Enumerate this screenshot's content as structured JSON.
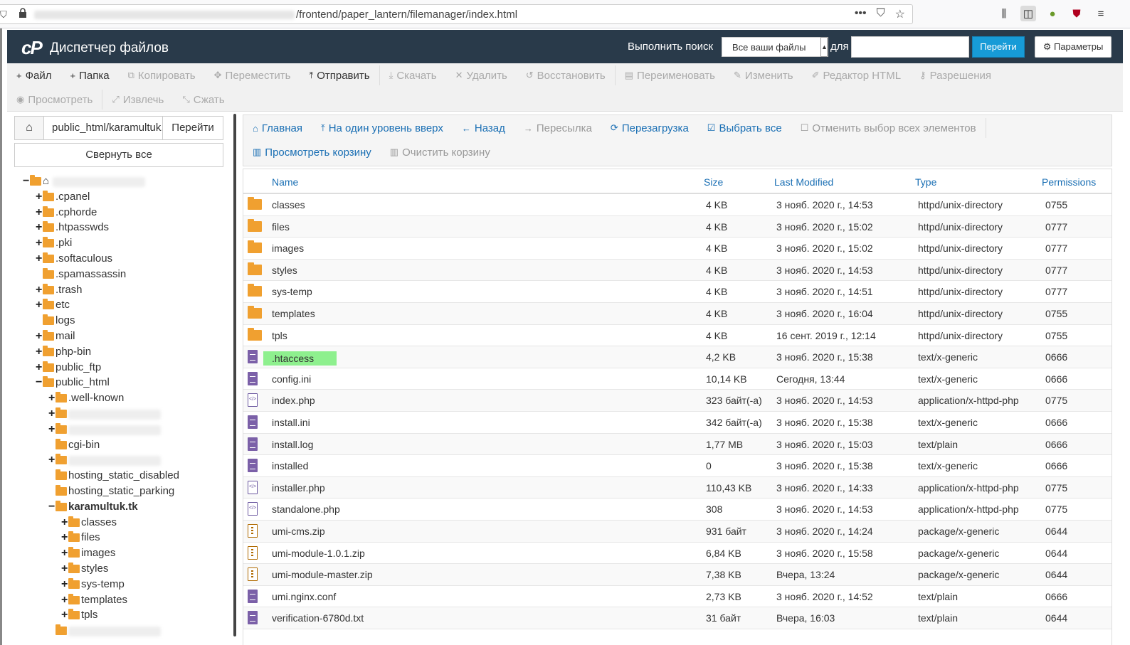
{
  "browser": {
    "url_suffix": "/frontend/paper_lantern/filemanager/index.html",
    "icons": [
      "more-icon",
      "pocket-icon",
      "star-icon",
      "library-icon",
      "sidebar-icon",
      "leaf-icon",
      "ublock-icon",
      "menu-icon"
    ]
  },
  "header": {
    "title": "Диспетчер файлов",
    "search_label": "Выполнить поиск",
    "search_scope": "Все ваши файлы",
    "for_label": "для",
    "go_label": "Перейти",
    "settings_label": "Параметры"
  },
  "toolbar": {
    "row1": [
      {
        "label": "Файл",
        "icon": "+",
        "enabled": true
      },
      {
        "label": "Папка",
        "icon": "+",
        "enabled": true
      },
      {
        "label": "Копировать",
        "icon": "⧉",
        "enabled": false
      },
      {
        "label": "Переместить",
        "icon": "✥",
        "enabled": false
      },
      {
        "label": "Отправить",
        "icon": "⤒",
        "enabled": true
      },
      {
        "label": "Скачать",
        "icon": "⤓",
        "enabled": false
      },
      {
        "label": "Удалить",
        "icon": "✕",
        "enabled": false
      },
      {
        "label": "Восстановить",
        "icon": "↺",
        "enabled": false
      },
      {
        "label": "Переименовать",
        "icon": "▤",
        "enabled": false
      },
      {
        "label": "Изменить",
        "icon": "✎",
        "enabled": false
      },
      {
        "label": "Редактор HTML",
        "icon": "✐",
        "enabled": false
      },
      {
        "label": "Разрешения",
        "icon": "⚷",
        "enabled": false
      }
    ],
    "row2": [
      {
        "label": "Просмотреть",
        "icon": "◉",
        "enabled": false
      },
      {
        "label": "Извлечь",
        "icon": "⤢",
        "enabled": false
      },
      {
        "label": "Сжать",
        "icon": "⤡",
        "enabled": false
      }
    ]
  },
  "left": {
    "path_value": "public_html/karamultuk.tk",
    "go_label": "Перейти",
    "collapse_label": "Свернуть все",
    "tree": [
      {
        "label": "",
        "toggle": "−",
        "level": 0,
        "home": true,
        "blur": true
      },
      {
        "label": ".cpanel",
        "toggle": "+",
        "level": 1
      },
      {
        "label": ".cphorde",
        "toggle": "+",
        "level": 1
      },
      {
        "label": ".htpasswds",
        "toggle": "+",
        "level": 1
      },
      {
        "label": ".pki",
        "toggle": "+",
        "level": 1
      },
      {
        "label": ".softaculous",
        "toggle": "+",
        "level": 1
      },
      {
        "label": ".spamassassin",
        "toggle": "",
        "level": 1
      },
      {
        "label": ".trash",
        "toggle": "+",
        "level": 1
      },
      {
        "label": "etc",
        "toggle": "+",
        "level": 1
      },
      {
        "label": "logs",
        "toggle": "",
        "level": 1
      },
      {
        "label": "mail",
        "toggle": "+",
        "level": 1
      },
      {
        "label": "php-bin",
        "toggle": "+",
        "level": 1
      },
      {
        "label": "public_ftp",
        "toggle": "+",
        "level": 1
      },
      {
        "label": "public_html",
        "toggle": "−",
        "level": 1,
        "open": true
      },
      {
        "label": ".well-known",
        "toggle": "+",
        "level": 2
      },
      {
        "label": "",
        "toggle": "+",
        "level": 2,
        "blur": true
      },
      {
        "label": "",
        "toggle": "+",
        "level": 2,
        "blur": true
      },
      {
        "label": "cgi-bin",
        "toggle": "",
        "level": 2
      },
      {
        "label": "",
        "toggle": "+",
        "level": 2,
        "blur": true
      },
      {
        "label": "hosting_static_disabled",
        "toggle": "",
        "level": 2
      },
      {
        "label": "hosting_static_parking",
        "toggle": "",
        "level": 2
      },
      {
        "label": "karamultuk.tk",
        "toggle": "−",
        "level": 2,
        "bold": true,
        "open": true
      },
      {
        "label": "classes",
        "toggle": "+",
        "level": 3
      },
      {
        "label": "files",
        "toggle": "+",
        "level": 3
      },
      {
        "label": "images",
        "toggle": "+",
        "level": 3
      },
      {
        "label": "styles",
        "toggle": "+",
        "level": 3
      },
      {
        "label": "sys-temp",
        "toggle": "+",
        "level": 3
      },
      {
        "label": "templates",
        "toggle": "+",
        "level": 3
      },
      {
        "label": "tpls",
        "toggle": "+",
        "level": 3
      },
      {
        "label": "",
        "toggle": "",
        "level": 2,
        "blur": true
      }
    ]
  },
  "nav": {
    "row1": [
      {
        "label": "Главная",
        "icon": "⌂",
        "enabled": true
      },
      {
        "label": "На один уровень вверх",
        "icon": "⤒",
        "enabled": true
      },
      {
        "label": "Назад",
        "icon": "←",
        "enabled": true
      },
      {
        "label": "Пересылка",
        "icon": "→",
        "enabled": false
      },
      {
        "label": "Перезагрузка",
        "icon": "⟳",
        "enabled": true
      },
      {
        "label": "Выбрать все",
        "icon": "☑",
        "enabled": true
      },
      {
        "label": "Отменить выбор всех элементов",
        "icon": "☐",
        "enabled": false
      }
    ],
    "row2": [
      {
        "label": "Просмотреть корзину",
        "icon": "🗑",
        "enabled": true
      },
      {
        "label": "Очистить корзину",
        "icon": "🗑",
        "enabled": false
      }
    ]
  },
  "table": {
    "headers": {
      "name": "Name",
      "size": "Size",
      "modified": "Last Modified",
      "type": "Type",
      "perms": "Permissions"
    },
    "rows": [
      {
        "icon": "folder",
        "name": "classes",
        "size": "4 KB",
        "modified": "3 нояб. 2020 г., 14:53",
        "type": "httpd/unix-directory",
        "perms": "0755"
      },
      {
        "icon": "folder",
        "name": "files",
        "size": "4 KB",
        "modified": "3 нояб. 2020 г., 15:02",
        "type": "httpd/unix-directory",
        "perms": "0777"
      },
      {
        "icon": "folder",
        "name": "images",
        "size": "4 KB",
        "modified": "3 нояб. 2020 г., 15:02",
        "type": "httpd/unix-directory",
        "perms": "0777"
      },
      {
        "icon": "folder",
        "name": "styles",
        "size": "4 KB",
        "modified": "3 нояб. 2020 г., 14:53",
        "type": "httpd/unix-directory",
        "perms": "0777"
      },
      {
        "icon": "folder",
        "name": "sys-temp",
        "size": "4 KB",
        "modified": "3 нояб. 2020 г., 14:51",
        "type": "httpd/unix-directory",
        "perms": "0777"
      },
      {
        "icon": "folder",
        "name": "templates",
        "size": "4 KB",
        "modified": "3 нояб. 2020 г., 16:04",
        "type": "httpd/unix-directory",
        "perms": "0755"
      },
      {
        "icon": "folder",
        "name": "tpls",
        "size": "4 KB",
        "modified": "16 сент. 2019 г., 12:14",
        "type": "httpd/unix-directory",
        "perms": "0755"
      },
      {
        "icon": "file",
        "name": ".htaccess",
        "size": "4,2 KB",
        "modified": "3 нояб. 2020 г., 15:38",
        "type": "text/x-generic",
        "perms": "0666",
        "highlight": true
      },
      {
        "icon": "file",
        "name": "config.ini",
        "size": "10,14 KB",
        "modified": "Сегодня, 13:44",
        "type": "text/x-generic",
        "perms": "0666"
      },
      {
        "icon": "code",
        "name": "index.php",
        "size": "323 байт(-а)",
        "modified": "3 нояб. 2020 г., 14:53",
        "type": "application/x-httpd-php",
        "perms": "0775"
      },
      {
        "icon": "file",
        "name": "install.ini",
        "size": "342 байт(-а)",
        "modified": "3 нояб. 2020 г., 15:38",
        "type": "text/x-generic",
        "perms": "0666"
      },
      {
        "icon": "file",
        "name": "install.log",
        "size": "1,77 MB",
        "modified": "3 нояб. 2020 г., 15:03",
        "type": "text/plain",
        "perms": "0666"
      },
      {
        "icon": "file",
        "name": "installed",
        "size": "0",
        "modified": "3 нояб. 2020 г., 15:38",
        "type": "text/x-generic",
        "perms": "0666"
      },
      {
        "icon": "code",
        "name": "installer.php",
        "size": "110,43 KB",
        "modified": "3 нояб. 2020 г., 14:33",
        "type": "application/x-httpd-php",
        "perms": "0775"
      },
      {
        "icon": "code",
        "name": "standalone.php",
        "size": "308",
        "modified": "3 нояб. 2020 г., 14:53",
        "type": "application/x-httpd-php",
        "perms": "0775"
      },
      {
        "icon": "zip",
        "name": "umi-cms.zip",
        "size": "931 байт",
        "modified": "3 нояб. 2020 г., 14:24",
        "type": "package/x-generic",
        "perms": "0644"
      },
      {
        "icon": "zip",
        "name": "umi-module-1.0.1.zip",
        "size": "6,84 KB",
        "modified": "3 нояб. 2020 г., 15:58",
        "type": "package/x-generic",
        "perms": "0644"
      },
      {
        "icon": "zip",
        "name": "umi-module-master.zip",
        "size": "7,38 KB",
        "modified": "Вчера, 13:24",
        "type": "package/x-generic",
        "perms": "0644"
      },
      {
        "icon": "file",
        "name": "umi.nginx.conf",
        "size": "2,73 KB",
        "modified": "3 нояб. 2020 г., 14:52",
        "type": "text/plain",
        "perms": "0666"
      },
      {
        "icon": "file",
        "name": "verification-6780d.txt",
        "size": "31 байт",
        "modified": "Вчера, 16:03",
        "type": "text/plain",
        "perms": "0644"
      }
    ]
  }
}
